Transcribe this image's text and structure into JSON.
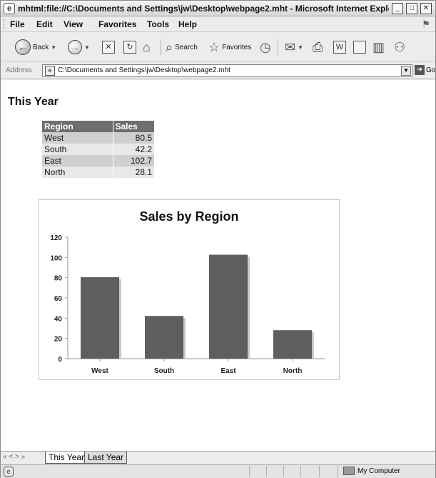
{
  "window": {
    "title": "mhtml:file://C:\\Documents and Settings\\jw\\Desktop\\webpage2.mht - Microsoft Internet Explo..."
  },
  "menu": [
    "File",
    "Edit",
    "View",
    "Favorites",
    "Tools",
    "Help"
  ],
  "toolbar": {
    "back_label": "Back",
    "search_label": "Search",
    "favorites_label": "Favorites"
  },
  "address": {
    "label": "Address",
    "url": "C:\\Documents and Settings\\jw\\Desktop\\webpage2.mht",
    "go_label": "Go"
  },
  "page": {
    "title": "This Year",
    "table": {
      "headers": [
        "Region",
        "Sales"
      ],
      "rows": [
        [
          "West",
          "80.5"
        ],
        [
          "South",
          "42.2"
        ],
        [
          "East",
          "102.7"
        ],
        [
          "North",
          "28.1"
        ]
      ]
    }
  },
  "chart_data": {
    "type": "bar",
    "title": "Sales by Region",
    "categories": [
      "West",
      "South",
      "East",
      "North"
    ],
    "values": [
      80.5,
      42.2,
      102.7,
      28.1
    ],
    "ylim": [
      0,
      120
    ],
    "yticks": [
      0,
      20,
      40,
      60,
      80,
      100,
      120
    ],
    "xlabel": "",
    "ylabel": "",
    "grid": false,
    "legend": "none",
    "bar_color": "#5e5e5e"
  },
  "sheets": {
    "nav": "« < > »",
    "tabs": [
      "This Year",
      "Last Year"
    ]
  },
  "status": {
    "zone": "My Computer"
  }
}
